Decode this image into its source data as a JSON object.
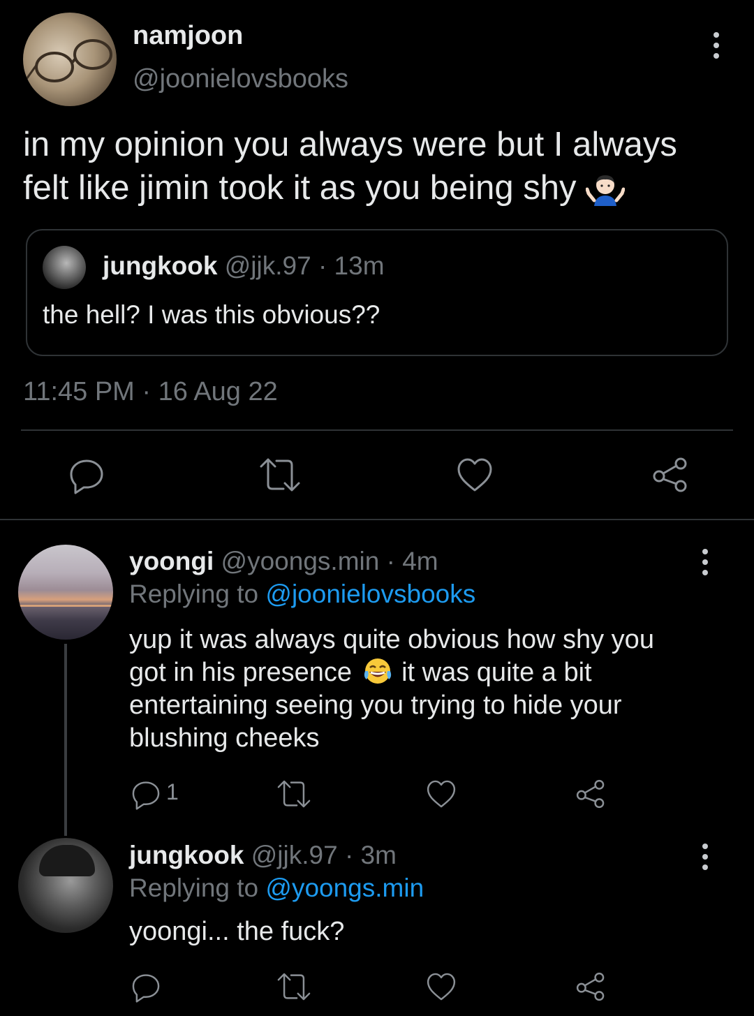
{
  "main_tweet": {
    "name": "namjoon",
    "handle": "@joonielovsbooks",
    "text_line1": "in my opinion you always were but I always",
    "text_line2": "felt like jimin took it as you being shy",
    "emoji": "person-shrugging",
    "quote": {
      "name": "jungkook",
      "meta": "@jjk.97 · 13m",
      "text": "the hell? I was this obvious??"
    },
    "timestamp": "11:45 PM · 16 Aug 22",
    "actions": [
      "reply-icon",
      "retweet-icon",
      "like-icon",
      "share-icon"
    ]
  },
  "replies": [
    {
      "name": "yoongi",
      "meta": "@yoongs.min · 4m",
      "replying_prefix": "Replying to ",
      "replying_to": "@joonielovsbooks",
      "line1": "yup it was always quite obvious how shy you",
      "line2a": "got in his presence",
      "emoji": "face-with-tears-of-joy",
      "line2b": "it was quite a bit",
      "line3": "entertaining seeing you trying to hide your",
      "line4": "blushing cheeks",
      "reply_count": "1"
    },
    {
      "name": "jungkook",
      "meta": "@jjk.97 · 3m",
      "replying_prefix": "Replying to ",
      "replying_to": "@yoongs.min",
      "text": "yoongi... the fuck?",
      "reply_count": ""
    }
  ],
  "colors": {
    "background": "#000000",
    "text": "#e7e9ea",
    "muted": "#71767b",
    "link": "#1d9bf0",
    "divider": "#2f3336"
  }
}
